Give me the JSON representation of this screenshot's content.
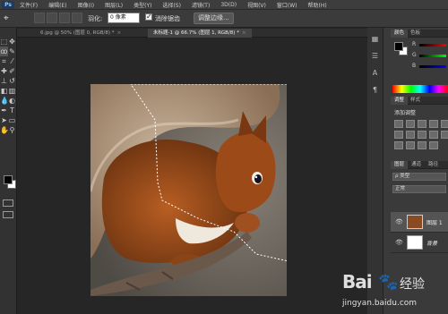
{
  "app": {
    "logo": "Ps"
  },
  "menu": [
    "文件(F)",
    "编辑(E)",
    "图像(I)",
    "图层(L)",
    "类型(Y)",
    "选择(S)",
    "滤镜(T)",
    "3D(D)",
    "视图(V)",
    "窗口(W)",
    "帮助(H)"
  ],
  "options": {
    "feather_label": "羽化:",
    "feather_value": "0 像素",
    "antialias_label": "消除锯齿",
    "refine_edge_label": "调整边缘..."
  },
  "tabs": [
    {
      "label": "6.jpg @ 50% (图层 0, RGB/8) *",
      "active": false
    },
    {
      "label": "未标题-1 @ 66.7% (图层 1, RGB/8) *",
      "active": true
    }
  ],
  "color_panel": {
    "tabs": [
      "颜色",
      "色板"
    ],
    "channels": [
      "R",
      "G",
      "B"
    ]
  },
  "adjust_panel": {
    "tabs": [
      "调整",
      "样式"
    ],
    "title": "添加调整"
  },
  "layers_panel": {
    "tabs": [
      "图层",
      "通道",
      "路径"
    ],
    "filter_label": "ρ 类型",
    "blend_mode": "正常",
    "layers": [
      {
        "name": "图层 1",
        "selected": true
      },
      {
        "name": "背景",
        "selected": false
      }
    ]
  },
  "watermark": {
    "brand": "Bai",
    "brand_suffix": "经验",
    "url": "jingyan.baidu.com"
  }
}
